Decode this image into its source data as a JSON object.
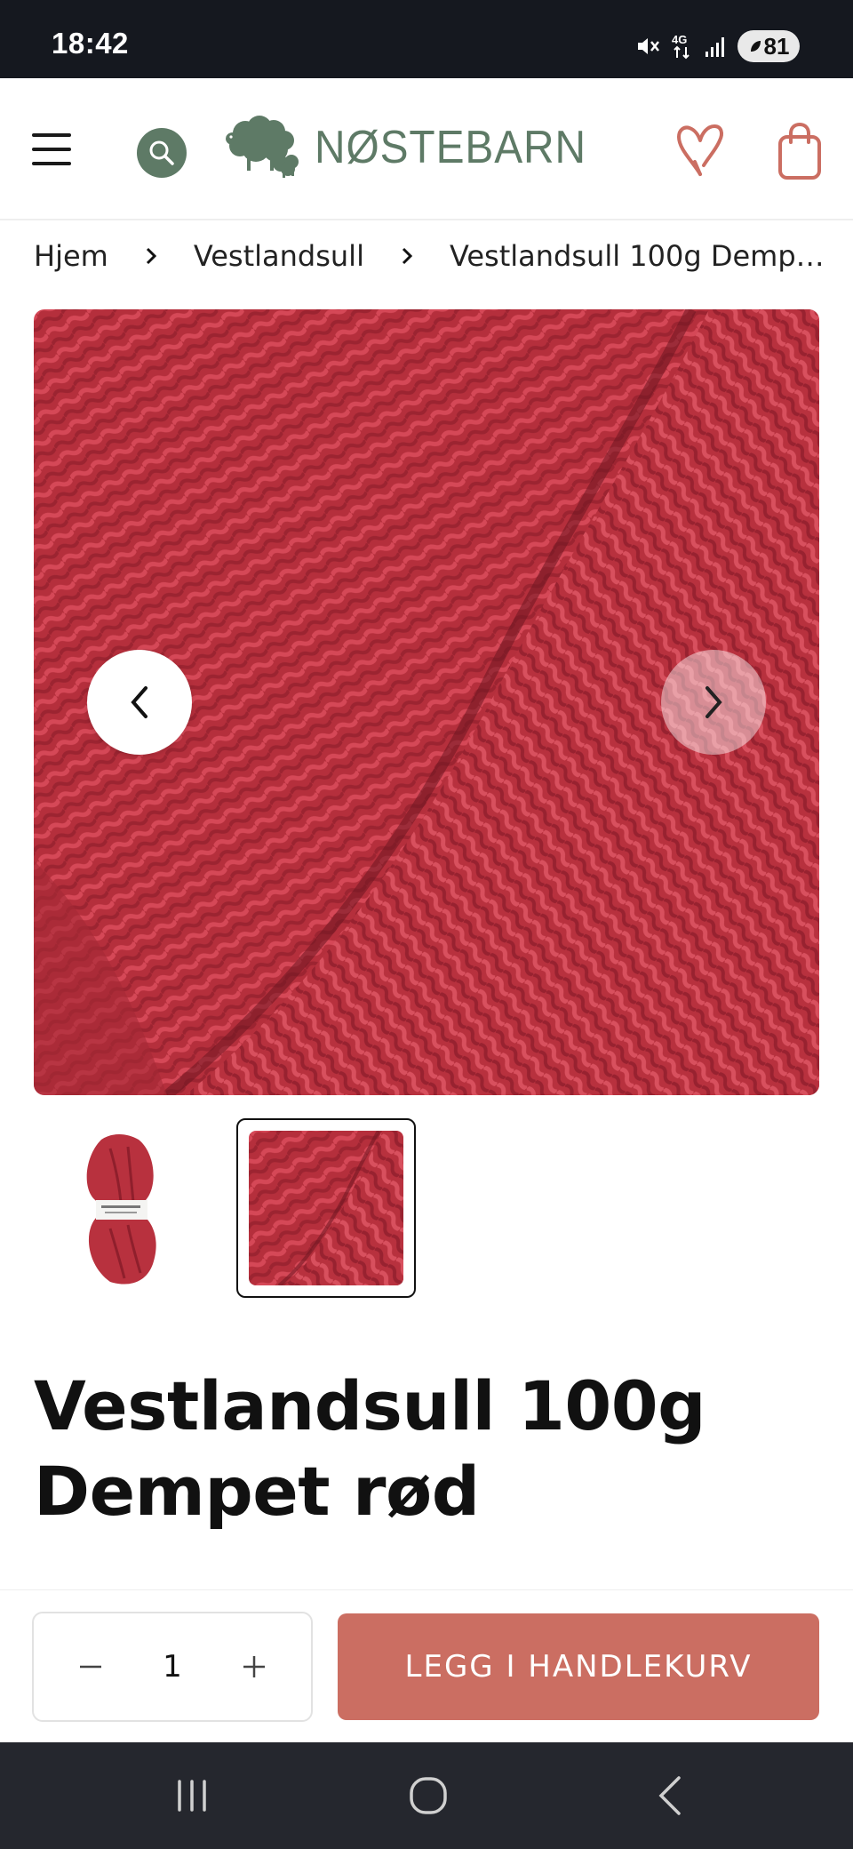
{
  "status_bar": {
    "time": "18:42",
    "network": "4G",
    "battery": "81",
    "icons": [
      "mute-icon",
      "4g-icon",
      "signal-icon",
      "battery-icon"
    ]
  },
  "header": {
    "brand": "NØSTEBARN",
    "brand_color": "#5e7a66",
    "accent_color": "#cb6e62",
    "icons": [
      "menu-icon",
      "search-icon",
      "sheep-logo-icon",
      "heart-icon",
      "shopping-bag-icon"
    ]
  },
  "breadcrumb": {
    "items": [
      "Hjem",
      "Vestlandsull"
    ],
    "current": "Vestlandsull 100g Dempe..."
  },
  "gallery": {
    "image_color": "#b8313e",
    "thumbnail_count": 2,
    "selected_index": 1,
    "icons": [
      "chevron-left-icon",
      "chevron-right-icon"
    ]
  },
  "product": {
    "title_line1": "Vestlandsull 100g",
    "title_line2": "Dempet rød"
  },
  "purchase": {
    "quantity": "1",
    "add_to_cart_label": "LEGG I HANDLEKURV",
    "icons": [
      "minus-icon",
      "plus-icon"
    ]
  },
  "android_nav": {
    "icons": [
      "recent-apps-icon",
      "home-icon",
      "back-icon"
    ]
  }
}
